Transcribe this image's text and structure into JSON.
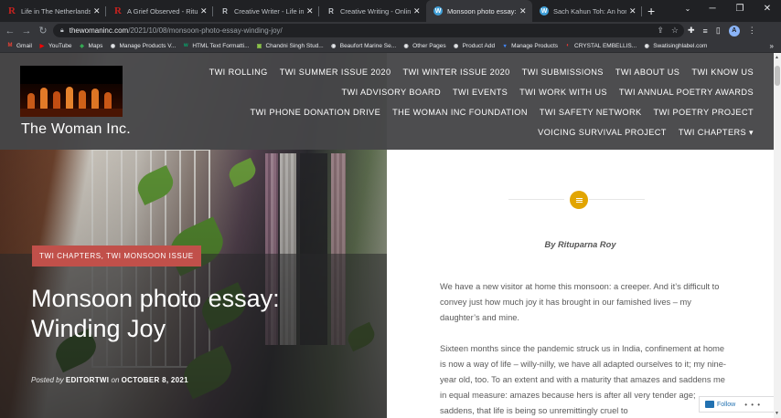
{
  "browser": {
    "tabs": [
      {
        "title": "Life in The Netherlands - R",
        "favicon": "R",
        "kind": "r"
      },
      {
        "title": "A Grief Observed - Ritupar",
        "favicon": "R",
        "kind": "r"
      },
      {
        "title": "Creative Writer - Life in Ne",
        "favicon": "R",
        "kind": "rg"
      },
      {
        "title": "Creative Writing - Online A",
        "favicon": "R",
        "kind": "rg"
      },
      {
        "title": "Monsoon photo essay: Wir",
        "favicon": "W",
        "kind": "wp"
      },
      {
        "title": "Sach Kahun Toh: An honest",
        "favicon": "W",
        "kind": "wp"
      }
    ],
    "active_tab_index": 4,
    "url_host": "thewomaninc.com",
    "url_path": "/2021/10/08/monsoon-photo-essay-winding-joy/",
    "profile_initial": "A",
    "bookmarks": [
      {
        "label": "Gmail",
        "icon": "M",
        "color": "#ea4335"
      },
      {
        "label": "YouTube",
        "icon": "▶",
        "color": "#ff0000"
      },
      {
        "label": "Maps",
        "icon": "◆",
        "color": "#34a853"
      },
      {
        "label": "Manage Products V...",
        "icon": "◉",
        "color": "#e8eaed"
      },
      {
        "label": "HTML Text Formatti...",
        "icon": "w",
        "color": "#04aa6d"
      },
      {
        "label": "Chandni Singh Stud...",
        "icon": "▣",
        "color": "#8bc34a"
      },
      {
        "label": "Beaufort Marine Se...",
        "icon": "◉",
        "color": "#e8eaed"
      },
      {
        "label": "Other Pages",
        "icon": "◉",
        "color": "#e8eaed"
      },
      {
        "label": "Product Add",
        "icon": "◉",
        "color": "#e8eaed"
      },
      {
        "label": "Manage Products",
        "icon": "▾",
        "color": "#4285f4"
      },
      {
        "label": "CRYSTAL EMBELLIS...",
        "icon": "◐",
        "color": "#e53935"
      },
      {
        "label": "Swatisinghlabel.com",
        "icon": "◉",
        "color": "#e8eaed"
      }
    ],
    "bookmarks_more": "»"
  },
  "site": {
    "title": "The Woman Inc.",
    "nav_rows": [
      [
        "TWI ROLLING",
        "TWI SUMMER ISSUE 2020",
        "TWI WINTER ISSUE 2020",
        "TWI SUBMISSIONS",
        "TWI ABOUT US",
        "TWI KNOW US"
      ],
      [
        "TWI ADVISORY BOARD",
        "TWI EVENTS",
        "TWI WORK WITH US",
        "TWI ANNUAL POETRY AWARDS"
      ],
      [
        "TWI PHONE DONATION DRIVE",
        "THE WOMAN INC FOUNDATION",
        "TWI SAFETY NETWORK",
        "TWI POETRY PROJECT"
      ],
      [
        "VOICING SURVIVAL PROJECT",
        "TWI CHAPTERS ▾"
      ]
    ]
  },
  "post": {
    "categories": "TWI CHAPTERS, TWI MONSOON ISSUE",
    "title": "Monsoon photo essay: Winding Joy",
    "posted_by_prefix": "Posted by",
    "author": "EDITORTWI",
    "on": "on",
    "date": "OCTOBER 8, 2021",
    "byline_author": "By Rituparna Roy",
    "paragraphs": [
      "We have a new visitor at home this monsoon: a creeper. And it’s difficult to convey just how much joy it has brought in our famished lives – my daughter’s and mine.",
      "Sixteen months since the pandemic struck us in India, confinement at home is now a way of life – willy-nilly, we have all adapted ourselves to it; my nine-year old, too. To an extent and with a maturity that amazes and saddens me in equal measure: amazes because hers is after all very tender age; saddens, that life is being so unremittingly cruel to"
    ]
  },
  "follow": {
    "label": "Follow",
    "more": "• • •"
  }
}
